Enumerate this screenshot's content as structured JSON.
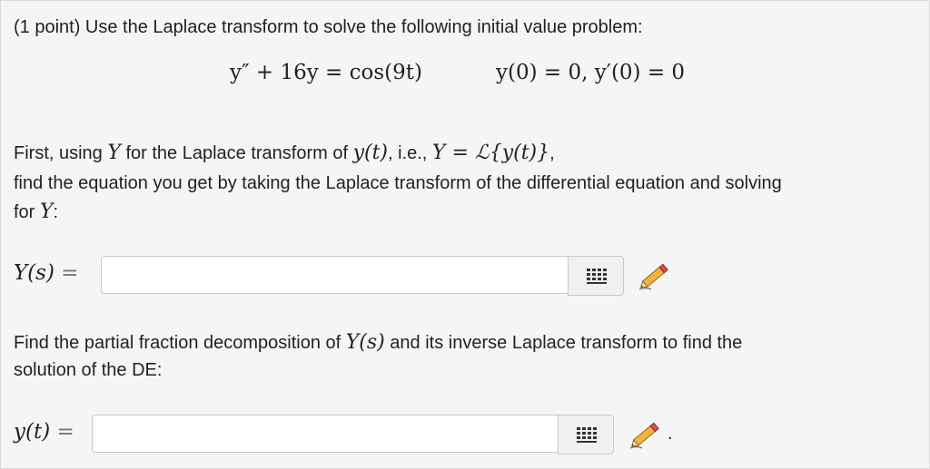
{
  "problem": {
    "intro": "(1 point) Use the Laplace transform to solve the following initial value problem:",
    "ode": "y″ + 16y = cos(9t)",
    "initial_conditions": "y(0) = 0,  y′(0) = 0"
  },
  "step1": {
    "line1_a": "First, using ",
    "line1_Y": "Y",
    "line1_b": " for the Laplace transform of ",
    "line1_yt": "y(t)",
    "line1_c": ", i.e., ",
    "line1_def": "Y = ℒ{y(t)}",
    "line1_d": ",",
    "line2": "find the equation you get by taking the Laplace transform of the differential equation and solving",
    "line3_a": "for ",
    "line3_Y": "Y",
    "line3_b": ":",
    "answer_label": "Y(s)",
    "equals": "=",
    "answer_value": ""
  },
  "step2": {
    "line1_a": "Find the partial fraction decomposition of ",
    "line1_Ys": "Y(s)",
    "line1_b": " and its inverse Laplace transform to find the",
    "line2": "solution of the DE:",
    "answer_label": "y(t)",
    "equals": "=",
    "answer_value": "",
    "trailing": "."
  },
  "icons": {
    "palette": "equation-grid-icon",
    "edit": "pencil-icon"
  }
}
